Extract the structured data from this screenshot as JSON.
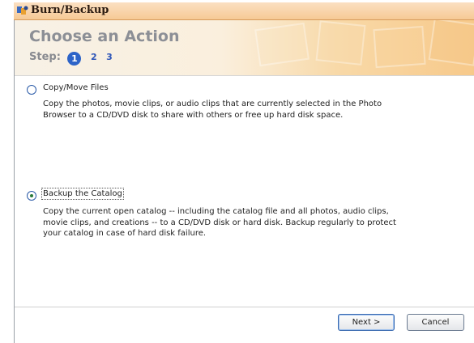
{
  "window": {
    "title": "Burn/Backup",
    "close_glyph": "✕"
  },
  "header": {
    "title": "Choose an Action",
    "step_label": "Step:",
    "steps": [
      "1",
      "2",
      "3"
    ],
    "current_step": "1"
  },
  "options": [
    {
      "label": "Copy/Move Files",
      "selected": false,
      "description": "Copy the photos, movie clips, or audio clips that are currently selected in the Photo Browser to a CD/DVD disk to share with others or free up hard disk space."
    },
    {
      "label": "Backup the Catalog",
      "selected": true,
      "description": "Copy the current open catalog -- including the catalog file and all photos, audio clips, movie clips, and creations -- to a CD/DVD disk or hard disk. Backup regularly to protect your catalog in case of hard disk failure."
    }
  ],
  "buttons": {
    "next": "Next >",
    "cancel": "Cancel"
  },
  "icons": {
    "title_icon": "app-icon",
    "close_icon": "close-icon"
  },
  "colors": {
    "accent": "#2d63c8",
    "title_bar": "#f6c995"
  }
}
